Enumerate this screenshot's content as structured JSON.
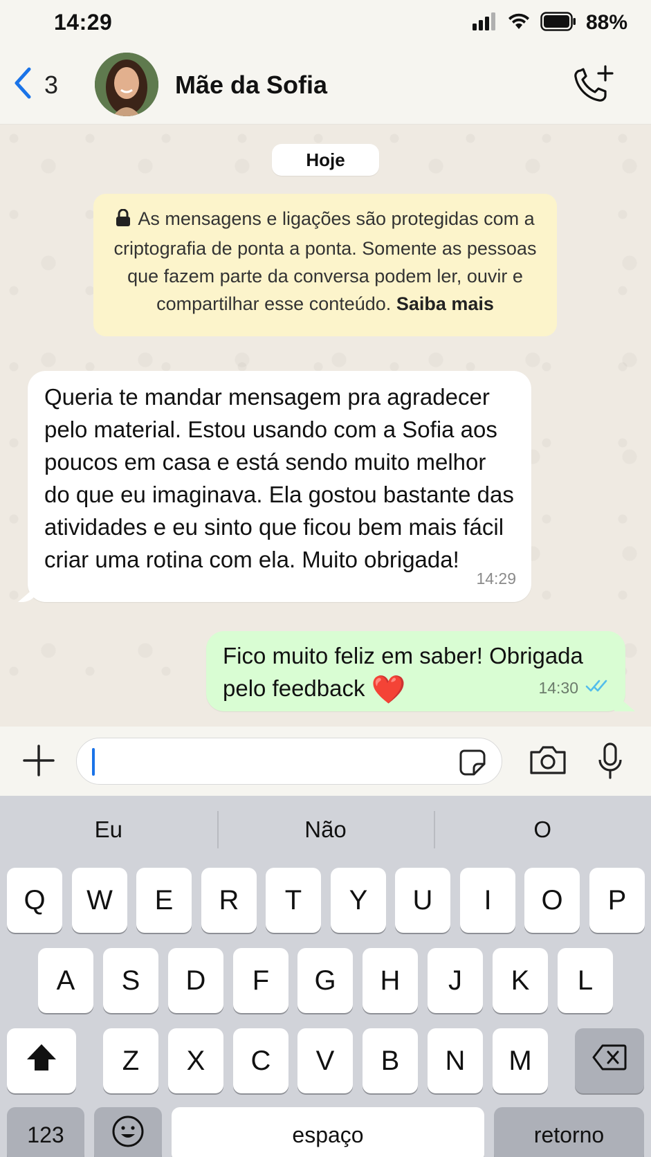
{
  "status_bar": {
    "time": "14:29",
    "battery_percent": "88%",
    "icons": [
      "signal-icon",
      "wifi-icon",
      "battery-icon"
    ]
  },
  "header": {
    "back_count": "3",
    "contact_name": "Mãe da Sofia",
    "icons": [
      "back-chevron-icon",
      "call-add-icon"
    ]
  },
  "chat": {
    "date_label": "Hoje",
    "encryption_notice": {
      "text": "As mensagens e ligações são protegidas com a criptografia de ponta a ponta. Somente as pessoas que fazem parte da conversa podem ler, ouvir e compartilhar esse conteúdo.",
      "link": "Saiba mais"
    },
    "messages": [
      {
        "direction": "incoming",
        "text": "Queria te mandar mensagem pra agradecer pelo material. Estou usando com a Sofia aos poucos em casa e está sendo muito melhor do que eu imaginava. Ela gostou bastante das atividades e eu sinto que ficou bem mais fácil criar uma rotina com ela. Muito obrigada!",
        "time": "14:29"
      },
      {
        "direction": "outgoing",
        "text": "Fico muito feliz em saber! Obrigada pelo feedback",
        "emoji": "❤️",
        "time": "14:30",
        "status": "read"
      }
    ]
  },
  "input_bar": {
    "value": "",
    "icons": [
      "plus-icon",
      "sticker-icon",
      "camera-icon",
      "microphone-icon"
    ]
  },
  "keyboard": {
    "suggestions": [
      "Eu",
      "Não",
      "O"
    ],
    "row1": [
      "Q",
      "W",
      "E",
      "R",
      "T",
      "Y",
      "U",
      "I",
      "O",
      "P"
    ],
    "row2": [
      "A",
      "S",
      "D",
      "F",
      "G",
      "H",
      "J",
      "K",
      "L"
    ],
    "row3": [
      "Z",
      "X",
      "C",
      "V",
      "B",
      "N",
      "M"
    ],
    "numbers_label": "123",
    "space_label": "espaço",
    "return_label": "retorno"
  },
  "colors": {
    "accent_blue": "#1a73e8",
    "outgoing_bubble": "#d9fdd3",
    "incoming_bubble": "#ffffff",
    "notice_bg": "#fcf4cb",
    "read_ticks": "#53bdeb",
    "heart": "#e0162b"
  }
}
